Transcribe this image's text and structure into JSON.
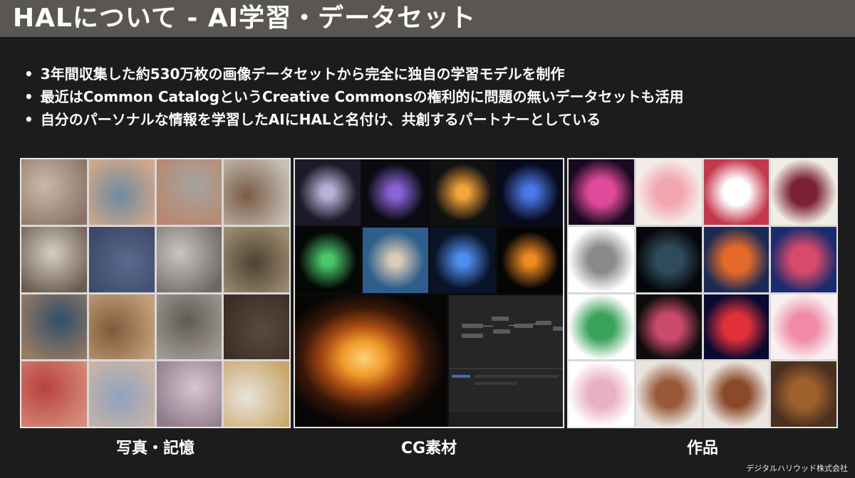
{
  "slide": {
    "title": "HALについて - AI学習・データセット",
    "bullets": [
      "3年間収集した約530万枚の画像データセットから完全に独自の学習モデルを制作",
      "最近はCommon CatalogというCreative Commonsの権利的に問題の無いデータセットも活用",
      "自分のパーソナルな情報を学習したAIにHALと名付け、共創するパートナーとしている"
    ],
    "footer": "デジタルハリウッド株式会社"
  },
  "panels": {
    "photos": {
      "caption": "写真・記憶",
      "tiles": [
        {
          "label": "baby-photo-1",
          "c1": "#c9b9aa",
          "c2": "#8a7465"
        },
        {
          "label": "baby-photo-2",
          "c1": "#6d8aa0",
          "c2": "#d2a88a"
        },
        {
          "label": "baby-photo-3",
          "c1": "#a7a3a0",
          "c2": "#b9876d"
        },
        {
          "label": "kids-photo-1",
          "c1": "#7a5b45",
          "c2": "#c7c0b6"
        },
        {
          "label": "kids-photo-2",
          "c1": "#d8cfc3",
          "c2": "#6a5b50"
        },
        {
          "label": "kid-portrait",
          "c1": "#5a6a8f",
          "c2": "#3c4866"
        },
        {
          "label": "kids-photo-3",
          "c1": "#c9c6c2",
          "c2": "#6c6762"
        },
        {
          "label": "room-photo",
          "c1": "#4b4232",
          "c2": "#9c8b70"
        },
        {
          "label": "tv-room-photo",
          "c1": "#2f4f6b",
          "c2": "#9a7b62"
        },
        {
          "label": "family-dinner",
          "c1": "#7d5a3a",
          "c2": "#c4a07a"
        },
        {
          "label": "group-photo",
          "c1": "#5f5a55",
          "c2": "#a19a92"
        },
        {
          "label": "blurred-photo-1",
          "c1": "#5a4a3c",
          "c2": "#3a2e25"
        },
        {
          "label": "blurred-photo-2",
          "c1": "#b8413d",
          "c2": "#d68b7a"
        },
        {
          "label": "blurred-photo-3",
          "c1": "#8fa2c0",
          "c2": "#c9b4a5"
        },
        {
          "label": "blurred-photo-4",
          "c1": "#d9c6d0",
          "c2": "#8e7a8a"
        },
        {
          "label": "blurred-photo-5",
          "c1": "#e9e4dc",
          "c2": "#c9a76b"
        }
      ]
    },
    "cg": {
      "caption": "CG素材",
      "tiles": [
        {
          "label": "vortex-render",
          "c1": "#b7b3d6",
          "c2": "#1b1b2a"
        },
        {
          "label": "purple-smoke",
          "c1": "#8a63d8",
          "c2": "#0a0a10"
        },
        {
          "label": "fire-smoke",
          "c1": "#f7a53a",
          "c2": "#111111"
        },
        {
          "label": "blue-burst",
          "c1": "#4a78e8",
          "c2": "#080a1a"
        },
        {
          "label": "green-ring",
          "c1": "#49c76a",
          "c2": "#050805"
        },
        {
          "label": "mushroom-cloud",
          "c1": "#d9cbb5",
          "c2": "#2d5e8c"
        },
        {
          "label": "blue-energy",
          "c1": "#4f8ef0",
          "c2": "#0a1428"
        },
        {
          "label": "flames",
          "c1": "#f08a22",
          "c2": "#050505"
        }
      ],
      "editor_label": "node-editor"
    },
    "works": {
      "caption": "作品",
      "tiles": [
        {
          "label": "ink-symmetry",
          "c1": "#e04a9a",
          "c2": "#1a0a20"
        },
        {
          "label": "rose-heart",
          "c1": "#f2a7b0",
          "c2": "#f4ece8"
        },
        {
          "label": "flower-triptych",
          "c1": "#ffffff",
          "c2": "#c4384c"
        },
        {
          "label": "flower-mandala",
          "c1": "#7a2234",
          "c2": "#f0ede6"
        },
        {
          "label": "smoke-symmetry",
          "c1": "#8a8a8a",
          "c2": "#ffffff"
        },
        {
          "label": "dark-ink",
          "c1": "#2f4a5a",
          "c2": "#05070a"
        },
        {
          "label": "kaleido-orange",
          "c1": "#e36a2a",
          "c2": "#1a2a55"
        },
        {
          "label": "fractal",
          "c1": "#d94a6a",
          "c2": "#1b2c6e"
        },
        {
          "label": "green-symmetry",
          "c1": "#3aa35a",
          "c2": "#ffffff"
        },
        {
          "label": "rose-sphere",
          "c1": "#c94a6a",
          "c2": "#0c0c0c"
        },
        {
          "label": "red-ink",
          "c1": "#e0303a",
          "c2": "#0a0a30"
        },
        {
          "label": "flower-pink",
          "c1": "#f08aa8",
          "c2": "#f8f0f2"
        },
        {
          "label": "floral-symmetry",
          "c1": "#e8b0c0",
          "c2": "#ffffff"
        },
        {
          "label": "clay-figure",
          "c1": "#9a5a3a",
          "c2": "#e8e4de"
        },
        {
          "label": "clay-sculpture",
          "c1": "#8a4a2a",
          "c2": "#ebe6e0"
        },
        {
          "label": "wood-frame",
          "c1": "#a0622c",
          "c2": "#4a3020"
        }
      ]
    }
  }
}
